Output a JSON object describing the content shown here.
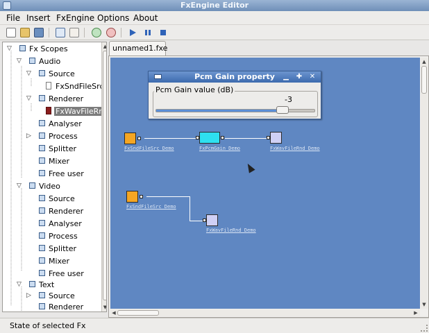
{
  "window": {
    "title": "FxEngine Editor"
  },
  "menu": {
    "items": [
      {
        "label": "File",
        "accel": "F"
      },
      {
        "label": "Insert",
        "accel": "I"
      },
      {
        "label": "FxEngine",
        "accel": "F"
      },
      {
        "label": "Options",
        "accel": "O"
      },
      {
        "label": "About",
        "accel": "A"
      }
    ]
  },
  "toolbar": {
    "buttons": [
      "new-icon",
      "open-icon",
      "save-icon",
      "properties-icon",
      "graph-icon",
      "zoom-in-icon",
      "zoom-out-icon",
      "play-icon",
      "pause-icon",
      "stop-icon"
    ]
  },
  "tree": {
    "root": "Fx Scopes",
    "audio": "Audio",
    "audio_source": "Source",
    "audio_source_child": "FxSndFileSrc",
    "audio_renderer": "Renderer",
    "audio_renderer_child": "FxWavFileRnd",
    "audio_analyser": "Analyser",
    "audio_process": "Process",
    "audio_splitter": "Splitter",
    "audio_mixer": "Mixer",
    "audio_free_user": "Free user",
    "video": "Video",
    "video_source": "Source",
    "video_renderer": "Renderer",
    "video_analyser": "Analyser",
    "video_process": "Process",
    "video_splitter": "Splitter",
    "video_mixer": "Mixer",
    "video_free_user": "Free user",
    "text": "Text",
    "text_source": "Source",
    "text_renderer": "Renderer"
  },
  "tabs": [
    {
      "label": "unnamed1.fxe"
    }
  ],
  "dialog": {
    "title": "Pcm Gain property",
    "group_label": "Pcm Gain value (dB)",
    "value": "-3",
    "slider_fraction": 0.82
  },
  "graph": {
    "nodes": [
      {
        "label": "FxSndFileSrc Demo",
        "color": "#f5a623"
      },
      {
        "label": "FxPcmGain Demo",
        "color": "#2ee0f0"
      },
      {
        "label": "FxWavFileRnd Demo",
        "color": "#cfd0f5"
      },
      {
        "label": "FxSndFileSrc Demo",
        "color": "#f5a623"
      },
      {
        "label": "FxWavFileRnd Demo",
        "color": "#cfd0f5"
      }
    ]
  },
  "status": {
    "text": "State of selected Fx"
  },
  "colors": {
    "canvas": "#5f87c2",
    "titlebar": "#6f8fb8",
    "dialog_title": "#3c6aae"
  }
}
